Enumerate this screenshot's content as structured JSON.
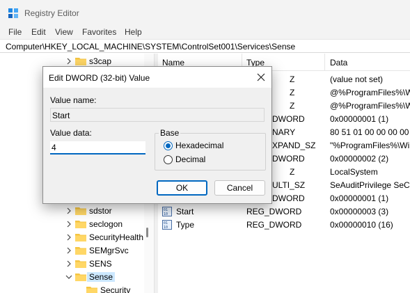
{
  "window": {
    "title": "Registry Editor"
  },
  "menu": [
    "File",
    "Edit",
    "View",
    "Favorites",
    "Help"
  ],
  "address": "Computer\\HKEY_LOCAL_MACHINE\\SYSTEM\\ControlSet001\\Services\\Sense",
  "tree": {
    "items": [
      {
        "label": "s3cap",
        "expandable": true
      },
      {
        "label": "sdstor",
        "expandable": true
      },
      {
        "label": "seclogon",
        "expandable": true
      },
      {
        "label": "SecurityHealth",
        "expandable": true
      },
      {
        "label": "SEMgrSvc",
        "expandable": true
      },
      {
        "label": "SENS",
        "expandable": true
      },
      {
        "label": "Sense",
        "expandable": true,
        "expanded": true,
        "selected": true
      },
      {
        "label": "Security",
        "expandable": false,
        "child": true
      }
    ]
  },
  "values": {
    "columns": [
      "Name",
      "Type",
      "Data"
    ],
    "rows": [
      {
        "name": "",
        "type": "Z",
        "data": "(value not set)"
      },
      {
        "name": "",
        "type": "Z",
        "data": "@%ProgramFiles%\\W"
      },
      {
        "name": "",
        "type": "Z",
        "data": "@%ProgramFiles%\\W"
      },
      {
        "name": "",
        "type": "DWORD",
        "data": "0x00000001 (1)"
      },
      {
        "name": "",
        "type": "NARY",
        "data": "80 51 01 00 00 00 00 00"
      },
      {
        "name": "",
        "type": "XPAND_SZ",
        "data": "\"%ProgramFiles%\\Wi"
      },
      {
        "name": "",
        "type": "DWORD",
        "data": "0x00000002 (2)"
      },
      {
        "name": "",
        "type": "Z",
        "data": "LocalSystem"
      },
      {
        "name": "",
        "type": "ULTI_SZ",
        "data": "SeAuditPrivilege SeCh"
      },
      {
        "name": "",
        "type": "DWORD",
        "data": "0x00000001 (1)"
      },
      {
        "name": "Start",
        "type": "REG_DWORD",
        "data": "0x00000003 (3)"
      },
      {
        "name": "Type",
        "type": "REG_DWORD",
        "data": "0x00000010 (16)"
      }
    ]
  },
  "dialog": {
    "title": "Edit DWORD (32-bit) Value",
    "value_name_label": "Value name:",
    "value_name": "Start",
    "value_data_label": "Value data:",
    "value_data": "4",
    "base_label": "Base",
    "base_options": [
      "Hexadecimal",
      "Decimal"
    ],
    "base_selected": "Hexadecimal",
    "ok_label": "OK",
    "cancel_label": "Cancel"
  },
  "colors": {
    "accent": "#0067c0",
    "folder": "#f5c542",
    "selection": "#cce8ff"
  }
}
